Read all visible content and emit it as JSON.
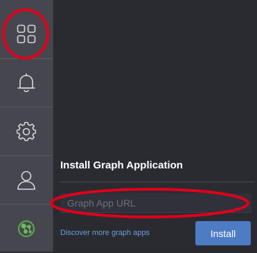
{
  "sidebar": {
    "items": [
      {
        "icon": "apps-grid-icon"
      },
      {
        "icon": "bell-icon"
      },
      {
        "icon": "gear-icon"
      },
      {
        "icon": "user-icon"
      },
      {
        "icon": "graph-app-logo-icon"
      }
    ]
  },
  "main": {
    "section_title": "Install Graph Application",
    "url_input": {
      "placeholder": "Graph App URL",
      "value": ""
    },
    "discover_link": "Discover more graph apps",
    "install_label": "Install"
  },
  "colors": {
    "annotation": "#e0001b",
    "accent_button": "#4d7cc4",
    "link": "#6b9fd8"
  }
}
